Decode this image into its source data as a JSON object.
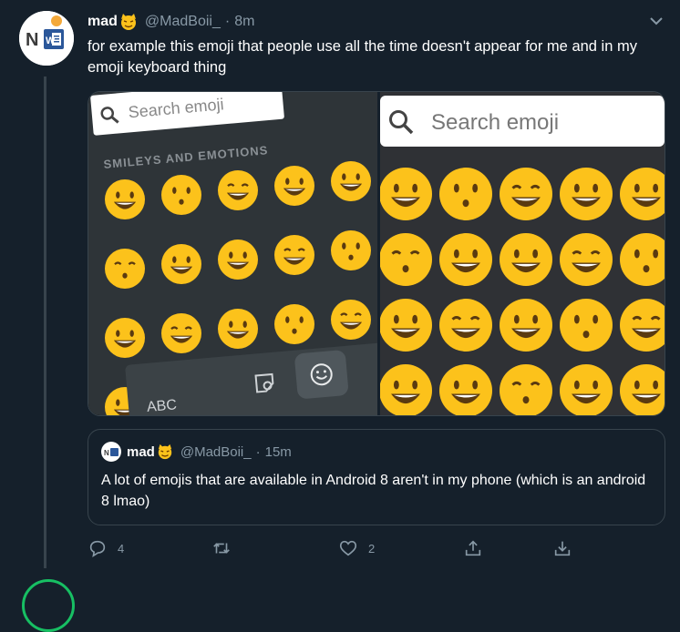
{
  "tweet": {
    "display_name": "mad",
    "handle": "@MadBoii_",
    "separator": "·",
    "time": "8m",
    "text": "for example this emoji that people use all the time doesn't appear for me and in my emoji keyboard thing"
  },
  "media": {
    "left_panel": {
      "search_placeholder": "Search emoji",
      "category": "SMILEYS AND EMOTIONS",
      "keyboard_label": "ABC"
    },
    "right_panel": {
      "search_placeholder": "Search emoji"
    }
  },
  "quoted_tweet": {
    "display_name": "mad",
    "handle": "@MadBoii_",
    "separator": "·",
    "time": "15m",
    "text": "A lot of emojis that are available in Android 8 aren't in my phone (which is an android 8 lmao)"
  },
  "actions": {
    "reply_count": "4",
    "retweet_count": "",
    "like_count": "2"
  },
  "colors": {
    "background": "#15202b",
    "border": "#38444d",
    "secondary_text": "#8899a6",
    "emoji_yellow": "#fcc21b"
  }
}
